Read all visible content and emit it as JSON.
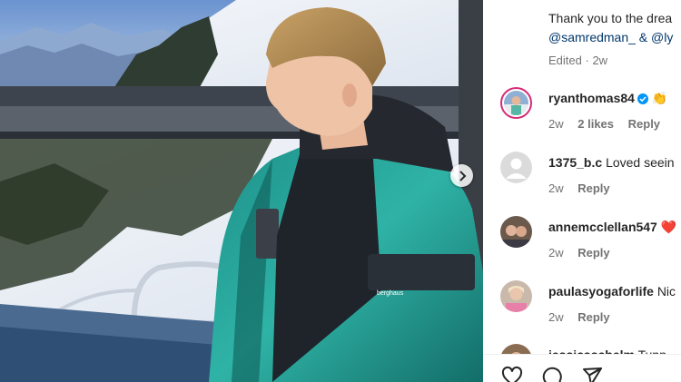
{
  "caption": {
    "text": "Thank you to the drea",
    "mentions": "@samredman_ & @ly",
    "edited": "Edited",
    "time": "2w"
  },
  "comments": [
    {
      "username": "ryanthomas84",
      "text": "👏",
      "time": "2w",
      "likes": "2 likes",
      "reply": "Reply",
      "verified": true,
      "avatar": "photo-ring-avatar"
    },
    {
      "username": "1375_b.c",
      "text": "Loved seein",
      "time": "2w",
      "reply": "Reply",
      "avatar": "default-user-avatar"
    },
    {
      "username": "annemcclellan547",
      "text": "❤️",
      "time": "2w",
      "reply": "Reply",
      "avatar": "photo-avatar"
    },
    {
      "username": "paulasyogaforlife",
      "text": "Nic",
      "time": "2w",
      "reply": "Reply",
      "avatar": "photo-avatar"
    },
    {
      "username": "jessicaschelm",
      "text": "Tupp",
      "avatar": "photo-avatar"
    }
  ],
  "actions": {
    "like_icon": "heart-icon",
    "comment_icon": "comment-icon",
    "share_icon": "share-icon"
  },
  "colors": {
    "link": "#00376b",
    "muted": "#737373",
    "verified": "#0095f6",
    "story_ring": "#d62976"
  }
}
